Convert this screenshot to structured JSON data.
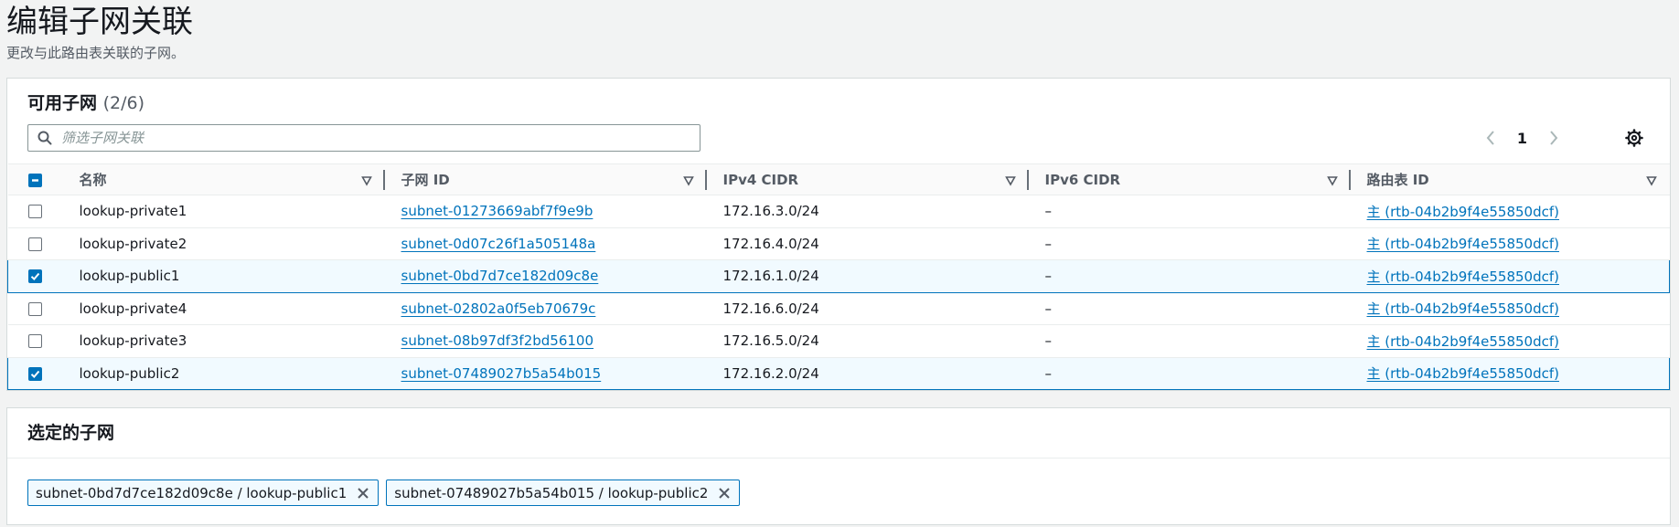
{
  "page": {
    "title": "编辑子网关联",
    "description": "更改与此路由表关联的子网。"
  },
  "available": {
    "title": "可用子网",
    "count": "(2/6)",
    "search_placeholder": "筛选子网关联",
    "page_number": "1",
    "columns": [
      "名称",
      "子网 ID",
      "IPv4 CIDR",
      "IPv6 CIDR",
      "路由表 ID"
    ],
    "rows": [
      {
        "name": "lookup-private1",
        "subnet_id": "subnet-01273669abf7f9e9b",
        "ipv4": "172.16.3.0/24",
        "ipv6": "–",
        "route_table": "主 (rtb-04b2b9f4e55850dcf)",
        "selected": false
      },
      {
        "name": "lookup-private2",
        "subnet_id": "subnet-0d07c26f1a505148a",
        "ipv4": "172.16.4.0/24",
        "ipv6": "–",
        "route_table": "主 (rtb-04b2b9f4e55850dcf)",
        "selected": false
      },
      {
        "name": "lookup-public1",
        "subnet_id": "subnet-0bd7d7ce182d09c8e",
        "ipv4": "172.16.1.0/24",
        "ipv6": "–",
        "route_table": "主 (rtb-04b2b9f4e55850dcf)",
        "selected": true
      },
      {
        "name": "lookup-private4",
        "subnet_id": "subnet-02802a0f5eb70679c",
        "ipv4": "172.16.6.0/24",
        "ipv6": "–",
        "route_table": "主 (rtb-04b2b9f4e55850dcf)",
        "selected": false
      },
      {
        "name": "lookup-private3",
        "subnet_id": "subnet-08b97df3f2bd56100",
        "ipv4": "172.16.5.0/24",
        "ipv6": "–",
        "route_table": "主 (rtb-04b2b9f4e55850dcf)",
        "selected": false
      },
      {
        "name": "lookup-public2",
        "subnet_id": "subnet-07489027b5a54b015",
        "ipv4": "172.16.2.0/24",
        "ipv6": "–",
        "route_table": "主 (rtb-04b2b9f4e55850dcf)",
        "selected": true
      }
    ]
  },
  "selected": {
    "title": "选定的子网",
    "tokens": [
      "subnet-0bd7d7ce182d09c8e / lookup-public1",
      "subnet-07489027b5a54b015 / lookup-public2"
    ]
  },
  "icons": {
    "search": "search-icon",
    "prev": "chevron-left-icon",
    "next": "chevron-right-icon",
    "settings": "gear-icon",
    "sort": "caret-down-icon",
    "remove": "close-icon"
  },
  "colors": {
    "accent": "#0073bb",
    "selected_row_bg": "#f1faff",
    "text": "#16191f",
    "muted_text": "#545b64"
  }
}
